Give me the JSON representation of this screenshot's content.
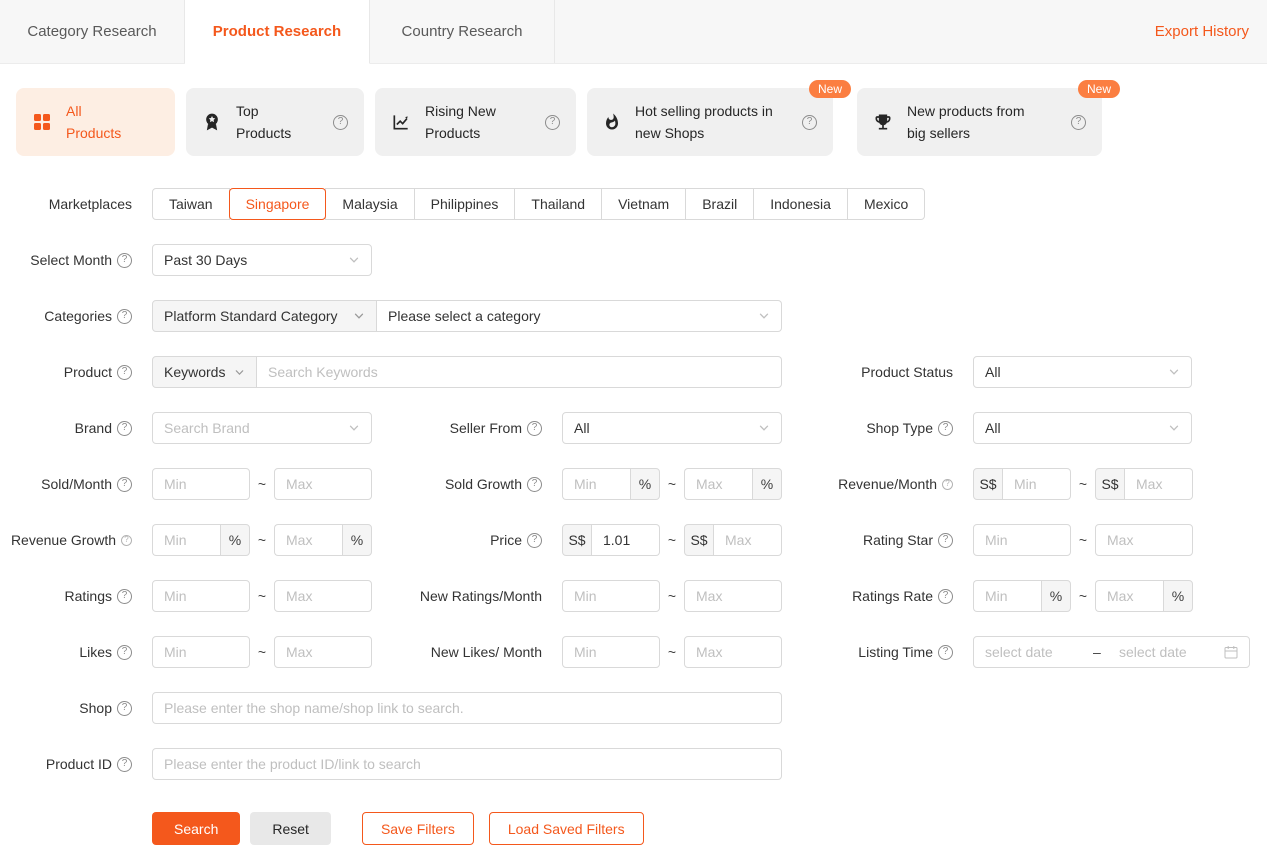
{
  "colors": {
    "accent": "#f4581c",
    "badge": "#fb7e41",
    "active_card_bg": "#fdeee3"
  },
  "icons": {
    "help_glyph": "?"
  },
  "header": {
    "tabs": [
      {
        "label": "Category Research"
      },
      {
        "label": "Product Research"
      },
      {
        "label": "Country Research"
      }
    ],
    "active_tab": "Product Research",
    "export_history_label": "Export History"
  },
  "product_type_cards": [
    {
      "label": "All Products",
      "icon": "apps-grid-icon",
      "active": true
    },
    {
      "label": "Top Products",
      "icon": "medal-icon",
      "has_help": true
    },
    {
      "label": "Rising New Products",
      "icon": "trend-chart-icon",
      "has_help": true
    },
    {
      "label": "Hot selling products in new Shops",
      "icon": "flame-icon",
      "has_help": true,
      "badge": "New"
    },
    {
      "label": "New products from big sellers",
      "icon": "trophy-icon",
      "has_help": true,
      "badge": "New"
    }
  ],
  "filters": {
    "range_separator": "~",
    "marketplaces": {
      "label": "Marketplaces",
      "options": [
        "Taiwan",
        "Singapore",
        "Malaysia",
        "Philippines",
        "Thailand",
        "Vietnam",
        "Brazil",
        "Indonesia",
        "Mexico"
      ],
      "selected": "Singapore"
    },
    "select_month": {
      "label": "Select Month",
      "value": "Past 30 Days"
    },
    "categories": {
      "label": "Categories",
      "type_selected": "Platform Standard Category",
      "category_placeholder": "Please select a category"
    },
    "product": {
      "label": "Product",
      "search_mode": "Keywords",
      "keyword_placeholder": "Search Keywords"
    },
    "product_status": {
      "label": "Product Status",
      "value": "All"
    },
    "brand": {
      "label": "Brand",
      "placeholder": "Search Brand"
    },
    "seller_from": {
      "label": "Seller From",
      "value": "All"
    },
    "shop_type": {
      "label": "Shop Type",
      "value": "All"
    },
    "sold_month": {
      "label": "Sold/Month",
      "min_placeholder": "Min",
      "max_placeholder": "Max"
    },
    "sold_growth": {
      "label": "Sold Growth",
      "min_placeholder": "Min",
      "max_placeholder": "Max",
      "unit": "%"
    },
    "revenue_month": {
      "label": "Revenue/Month",
      "currency": "S$",
      "min_placeholder": "Min",
      "max_placeholder": "Max"
    },
    "revenue_growth": {
      "label": "Revenue Growth",
      "min_placeholder": "Min",
      "max_placeholder": "Max",
      "unit": "%"
    },
    "price": {
      "label": "Price",
      "currency": "S$",
      "min_value": "1.01",
      "max_placeholder": "Max"
    },
    "rating_star": {
      "label": "Rating Star",
      "min_placeholder": "Min",
      "max_placeholder": "Max"
    },
    "ratings": {
      "label": "Ratings",
      "min_placeholder": "Min",
      "max_placeholder": "Max"
    },
    "new_ratings_month": {
      "label": "New Ratings/Month",
      "min_placeholder": "Min",
      "max_placeholder": "Max"
    },
    "ratings_rate": {
      "label": "Ratings Rate",
      "min_placeholder": "Min",
      "max_placeholder": "Max",
      "unit": "%"
    },
    "likes": {
      "label": "Likes",
      "min_placeholder": "Min",
      "max_placeholder": "Max"
    },
    "new_likes_month": {
      "label": "New Likes/ Month",
      "min_placeholder": "Min",
      "max_placeholder": "Max"
    },
    "listing_time": {
      "label": "Listing Time",
      "start_placeholder": "select date",
      "end_placeholder": "select date",
      "separator": "–"
    },
    "shop": {
      "label": "Shop",
      "placeholder": "Please enter the shop name/shop link to search."
    },
    "product_id": {
      "label": "Product ID",
      "placeholder": "Please enter the product ID/link to search"
    }
  },
  "actions": {
    "search": "Search",
    "reset": "Reset",
    "save_filters": "Save Filters",
    "load_saved_filters": "Load Saved Filters"
  }
}
